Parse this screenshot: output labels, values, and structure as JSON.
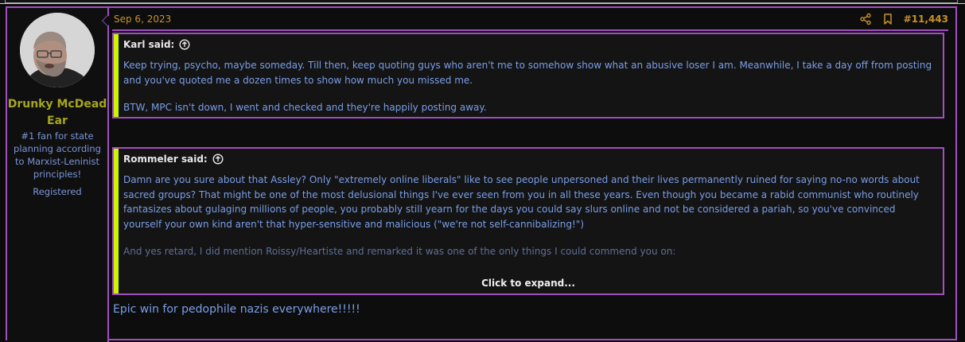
{
  "post": {
    "date": "Sep 6, 2023",
    "number": "#11,443",
    "message": "Epic win for pedophile nazis everywhere!!!!!"
  },
  "user": {
    "name": "Drunky McDead Ear",
    "title": "#1 fan for state planning according to Marxist-Leninist principles!",
    "banner": "Registered"
  },
  "quotes": [
    {
      "author": "Karl said:",
      "paragraphs": [
        "Keep trying, psycho, maybe someday. Till then, keep quoting guys who aren't me to somehow show what an abusive loser I am. Meanwhile, I take a day off from posting and you've quoted me a dozen times to show how much you missed me.",
        "BTW, MPC isn't down, I went and checked and they're happily posting away."
      ]
    },
    {
      "author": "Rommeler said:",
      "paragraphs": [
        "Damn are you sure about that Assley? Only \"extremely online liberals\" like to see people unpersoned and their lives permanently ruined for saying no-no words about sacred groups? That might be one of the most delusional things I've ever seen from you in all these years. Even though you became a rabid communist who routinely fantasizes about gulaging millions of people, you probably still yearn for the days you could say slurs online and not be considered a pariah, so you've convinced yourself your own kind aren't that hyper-sensitive and malicious (\"we're not self-cannibalizing!\")",
        "And yes retard, I did mention Roissy/Heartiste and remarked it was one of the only things I could commend you on:"
      ],
      "expand_label": "Click to expand..."
    }
  ],
  "icons": {
    "share": "share-icon",
    "bookmark": "bookmark-icon",
    "goto": "arrow-up-circle-icon"
  },
  "colors": {
    "accent_border": "#a24fc0",
    "quote_bar": "#ccf500",
    "username": "#a6a61e",
    "date": "#c8922a",
    "text_link": "#7a9ee8"
  }
}
